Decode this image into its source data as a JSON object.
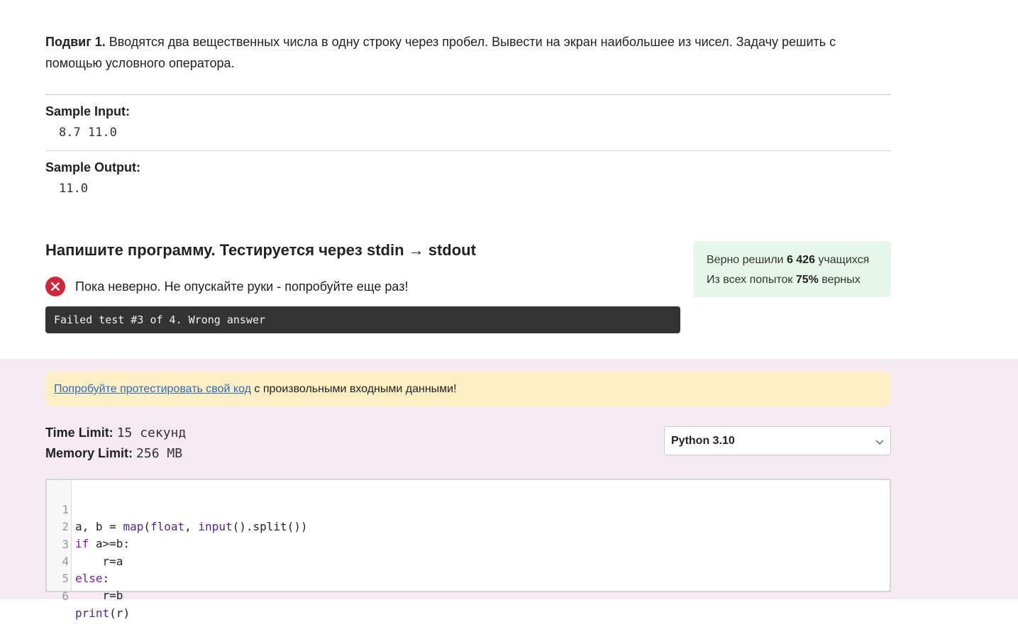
{
  "problem": {
    "title": "Подвиг 1.",
    "text": "Вводятся два вещественных числа в одну строку через пробел. Вывести на экран наибольшее из чисел. Задачу решить с помощью условного оператора."
  },
  "sample_input": {
    "label": "Sample Input:",
    "value": "8.7 11.0"
  },
  "sample_output": {
    "label": "Sample Output:",
    "value": "11.0"
  },
  "submission": {
    "heading": "Напишите программу. Тестируется через stdin → stdout",
    "result_text": "Пока неверно. Не опускайте руки - попробуйте еще раз!",
    "console_text": "Failed test #3 of 4. Wrong answer"
  },
  "stats": {
    "solved_prefix": "Верно решили ",
    "solved_count": "6 426",
    "solved_suffix": " учащихся",
    "attempts_prefix": "Из всех попыток ",
    "attempts_percent": "75%",
    "attempts_suffix": " верных"
  },
  "hint": {
    "link_text": "Попробуйте протестировать свой код",
    "rest_text": " с произвольными входными данными!"
  },
  "limits": {
    "time_label": "Time Limit:",
    "time_value": "15 секунд",
    "memory_label": "Memory Limit:",
    "memory_value": "256 MB"
  },
  "language_select": {
    "value": "Python 3.10"
  },
  "editor": {
    "lines": [
      {
        "num": "1"
      },
      {
        "num": "2"
      },
      {
        "num": "3"
      },
      {
        "num": "4"
      },
      {
        "num": "5"
      },
      {
        "num": "6"
      }
    ]
  },
  "colors": {
    "error": "#d0283a",
    "stats_bg": "#e6f6e8",
    "hint_bg": "#fdefc3",
    "lower_bg": "#f5eaf2",
    "console_bg": "#333333",
    "link": "#2a6bc0"
  }
}
